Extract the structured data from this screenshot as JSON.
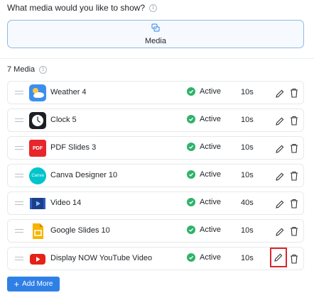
{
  "question": {
    "text": "What media would you like to show?",
    "info_icon": "info-icon"
  },
  "media_tile": {
    "label": "Media",
    "icon": "media-icon"
  },
  "media_count": {
    "text": "7 Media",
    "info_icon": "info-icon"
  },
  "items": [
    {
      "name": "Weather 4",
      "status": "Active",
      "duration": "10s",
      "thumb_icon": "weather-icon"
    },
    {
      "name": "Clock 5",
      "status": "Active",
      "duration": "10s",
      "thumb_icon": "clock-icon"
    },
    {
      "name": "PDF Slides 3",
      "status": "Active",
      "duration": "10s",
      "thumb_icon": "pdf-icon",
      "thumb_text": "PDF"
    },
    {
      "name": "Canva Designer 10",
      "status": "Active",
      "duration": "10s",
      "thumb_icon": "canva-icon",
      "thumb_text": "Canva"
    },
    {
      "name": "Video 14",
      "status": "Active",
      "duration": "40s",
      "thumb_icon": "video-icon"
    },
    {
      "name": "Google Slides 10",
      "status": "Active",
      "duration": "10s",
      "thumb_icon": "google-slides-icon"
    },
    {
      "name": "Display NOW YouTube Video",
      "status": "Active",
      "duration": "10s",
      "thumb_icon": "youtube-icon",
      "edit_highlighted": true
    }
  ],
  "add_button": {
    "label": "Add More",
    "plus": "+"
  },
  "colors": {
    "accent": "#2f80e6",
    "active": "#2fb36a",
    "highlight": "#d9262c"
  }
}
